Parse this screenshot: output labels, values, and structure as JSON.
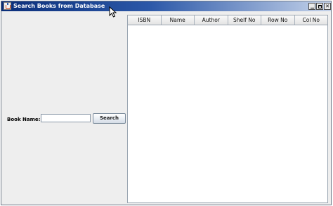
{
  "window": {
    "title": "Search Books from Database",
    "app_icon": "java-cup-icon"
  },
  "search_form": {
    "label": "Book Name:",
    "input_value": "",
    "button_label": "Search"
  },
  "results_table": {
    "columns": [
      "ISBN",
      "Name",
      "Author",
      "Shelf No",
      "Row No",
      "Col No"
    ],
    "rows": []
  }
}
